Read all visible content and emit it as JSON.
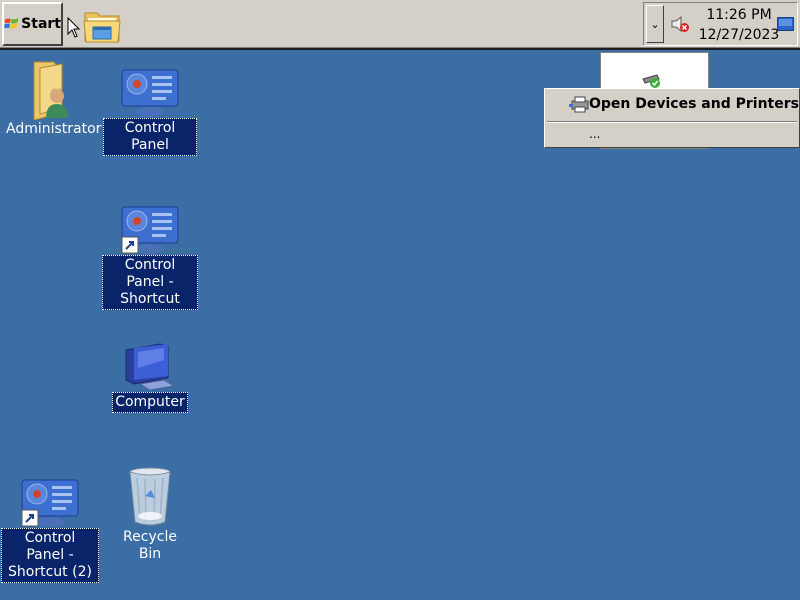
{
  "taskbar": {
    "start_label": "Start",
    "quick_launch": [
      {
        "icon": "windows-explorer-icon"
      }
    ],
    "tray": {
      "overflow_chevron": "⌄",
      "volume_icon": "muted-speaker-icon",
      "time": "11:26 PM",
      "date": "12/27/2023",
      "show_desktop_icon": "show-desktop-icon"
    }
  },
  "desktop": {
    "background_color": "#3a6ea5",
    "icons": [
      {
        "label": "Administrator",
        "icon": "user-folder-icon",
        "selected": false
      },
      {
        "label": "Control Panel",
        "icon": "control-panel-icon",
        "selected": true
      },
      {
        "label": "Control Panel - Shortcut",
        "icon": "control-panel-shortcut-icon",
        "selected": true
      },
      {
        "label": "Computer",
        "icon": "computer-icon",
        "selected": true
      },
      {
        "label": "Control Panel - Shortcut (2)",
        "icon": "control-panel-shortcut-icon",
        "selected": true
      },
      {
        "label": "Recycle Bin",
        "icon": "recycle-bin-icon",
        "selected": false
      }
    ]
  },
  "context_menu": {
    "items": [
      {
        "label": "Open Devices and Printers",
        "icon": "devices-printers-icon",
        "bold": true
      },
      {
        "label": "..."
      }
    ]
  },
  "notification_popup": {
    "icon": "safely-remove-hardware-icon"
  }
}
